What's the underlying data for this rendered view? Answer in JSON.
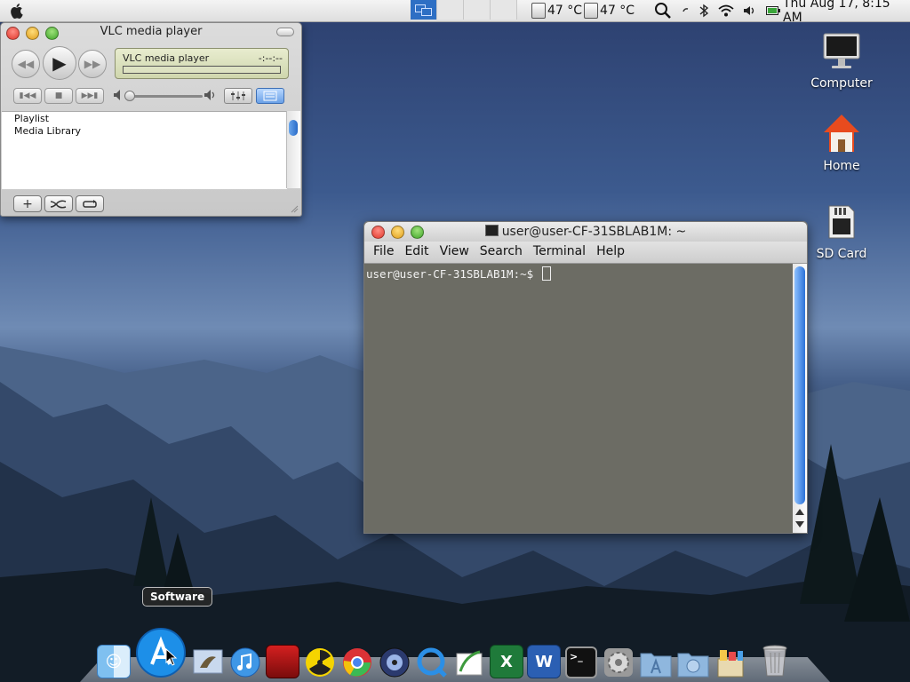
{
  "menubar": {
    "temp1": "47 °C",
    "temp2": "47 °C",
    "clock": "Thu Aug 17,  8:15 AM"
  },
  "vlc": {
    "title": "VLC media player",
    "lcd_title": "VLC media player",
    "lcd_time": "-:--:--",
    "playlist_items": [
      "Playlist",
      "Media Library"
    ],
    "volume_level": 0
  },
  "terminal": {
    "title": "user@user-CF-31SBLAB1M: ~",
    "menu": [
      "File",
      "Edit",
      "View",
      "Search",
      "Terminal",
      "Help"
    ],
    "prompt": "user@user-CF-31SBLAB1M:~$ "
  },
  "desktop_icons": [
    {
      "label": "Computer",
      "icon": "computer-icon"
    },
    {
      "label": "Home",
      "icon": "home-icon"
    },
    {
      "label": "SD Card",
      "icon": "sd-card-icon"
    }
  ],
  "dock": {
    "tooltip": "Software",
    "items": [
      {
        "name": "finder-icon"
      },
      {
        "name": "software-icon"
      },
      {
        "name": "mail-icon"
      },
      {
        "name": "itunes-icon"
      },
      {
        "name": "photo-booth-icon"
      },
      {
        "name": "radiation-icon"
      },
      {
        "name": "chrome-icon"
      },
      {
        "name": "dvd-player-icon"
      },
      {
        "name": "quicktime-icon"
      },
      {
        "name": "preview-icon"
      },
      {
        "name": "excel-icon"
      },
      {
        "name": "word-icon"
      },
      {
        "name": "terminal-icon"
      },
      {
        "name": "system-preferences-icon"
      },
      {
        "name": "applications-folder-icon"
      },
      {
        "name": "downloads-folder-icon"
      },
      {
        "name": "archive-utility-icon"
      },
      {
        "name": "trash-icon"
      }
    ]
  }
}
